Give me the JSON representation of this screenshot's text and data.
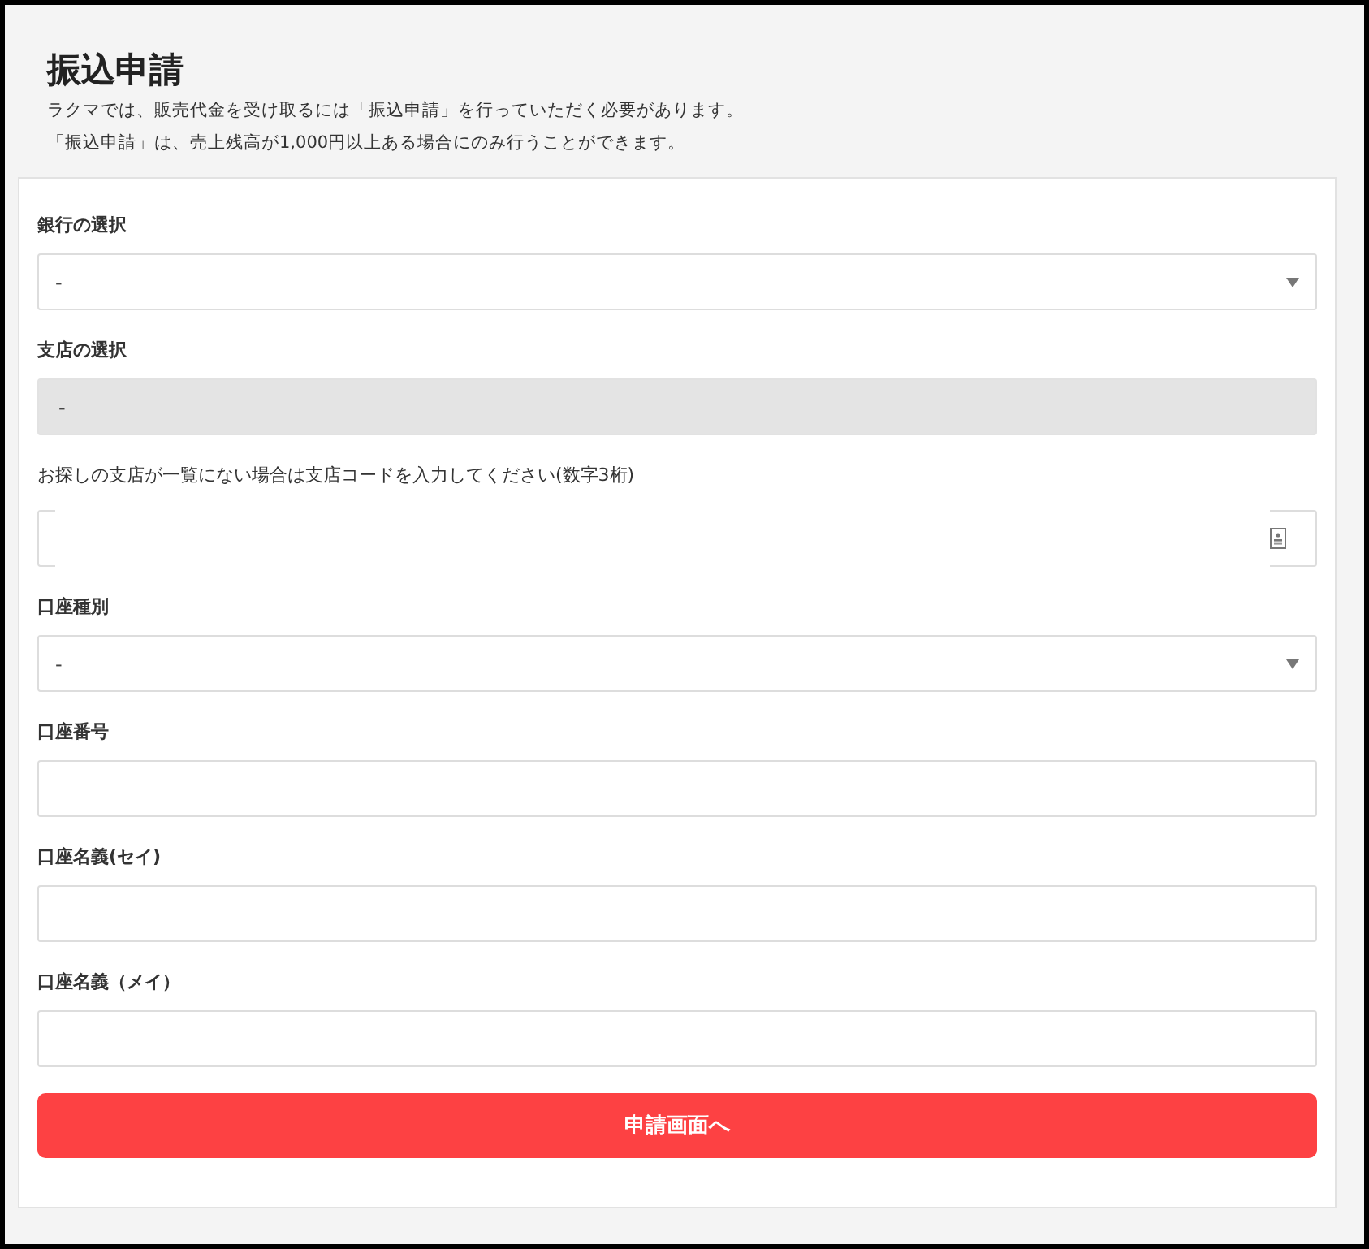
{
  "header": {
    "title": "振込申請",
    "notes": [
      "ラクマでは、販売代金を受け取るには「振込申請」を行っていただく必要があります。",
      "「振込申請」は、売上残高が1,000円以上ある場合にのみ行うことができます。"
    ]
  },
  "fields": [
    {
      "kind": "select",
      "label": "銀行の選択",
      "value": "-",
      "disabled": false
    },
    {
      "kind": "select",
      "label": "支店の選択",
      "value": "-",
      "disabled": true
    },
    {
      "kind": "code",
      "label": "お探しの支店が一覧にない場合は支店コードを入力してください(数字3桁)"
    },
    {
      "kind": "select",
      "label": "口座種別",
      "value": "-",
      "disabled": false
    },
    {
      "kind": "text",
      "label": "口座番号"
    },
    {
      "kind": "text",
      "label": "口座名義(セイ)"
    },
    {
      "kind": "text",
      "label": "口座名義（メイ）"
    }
  ],
  "submit": {
    "label": "申請画面へ"
  }
}
